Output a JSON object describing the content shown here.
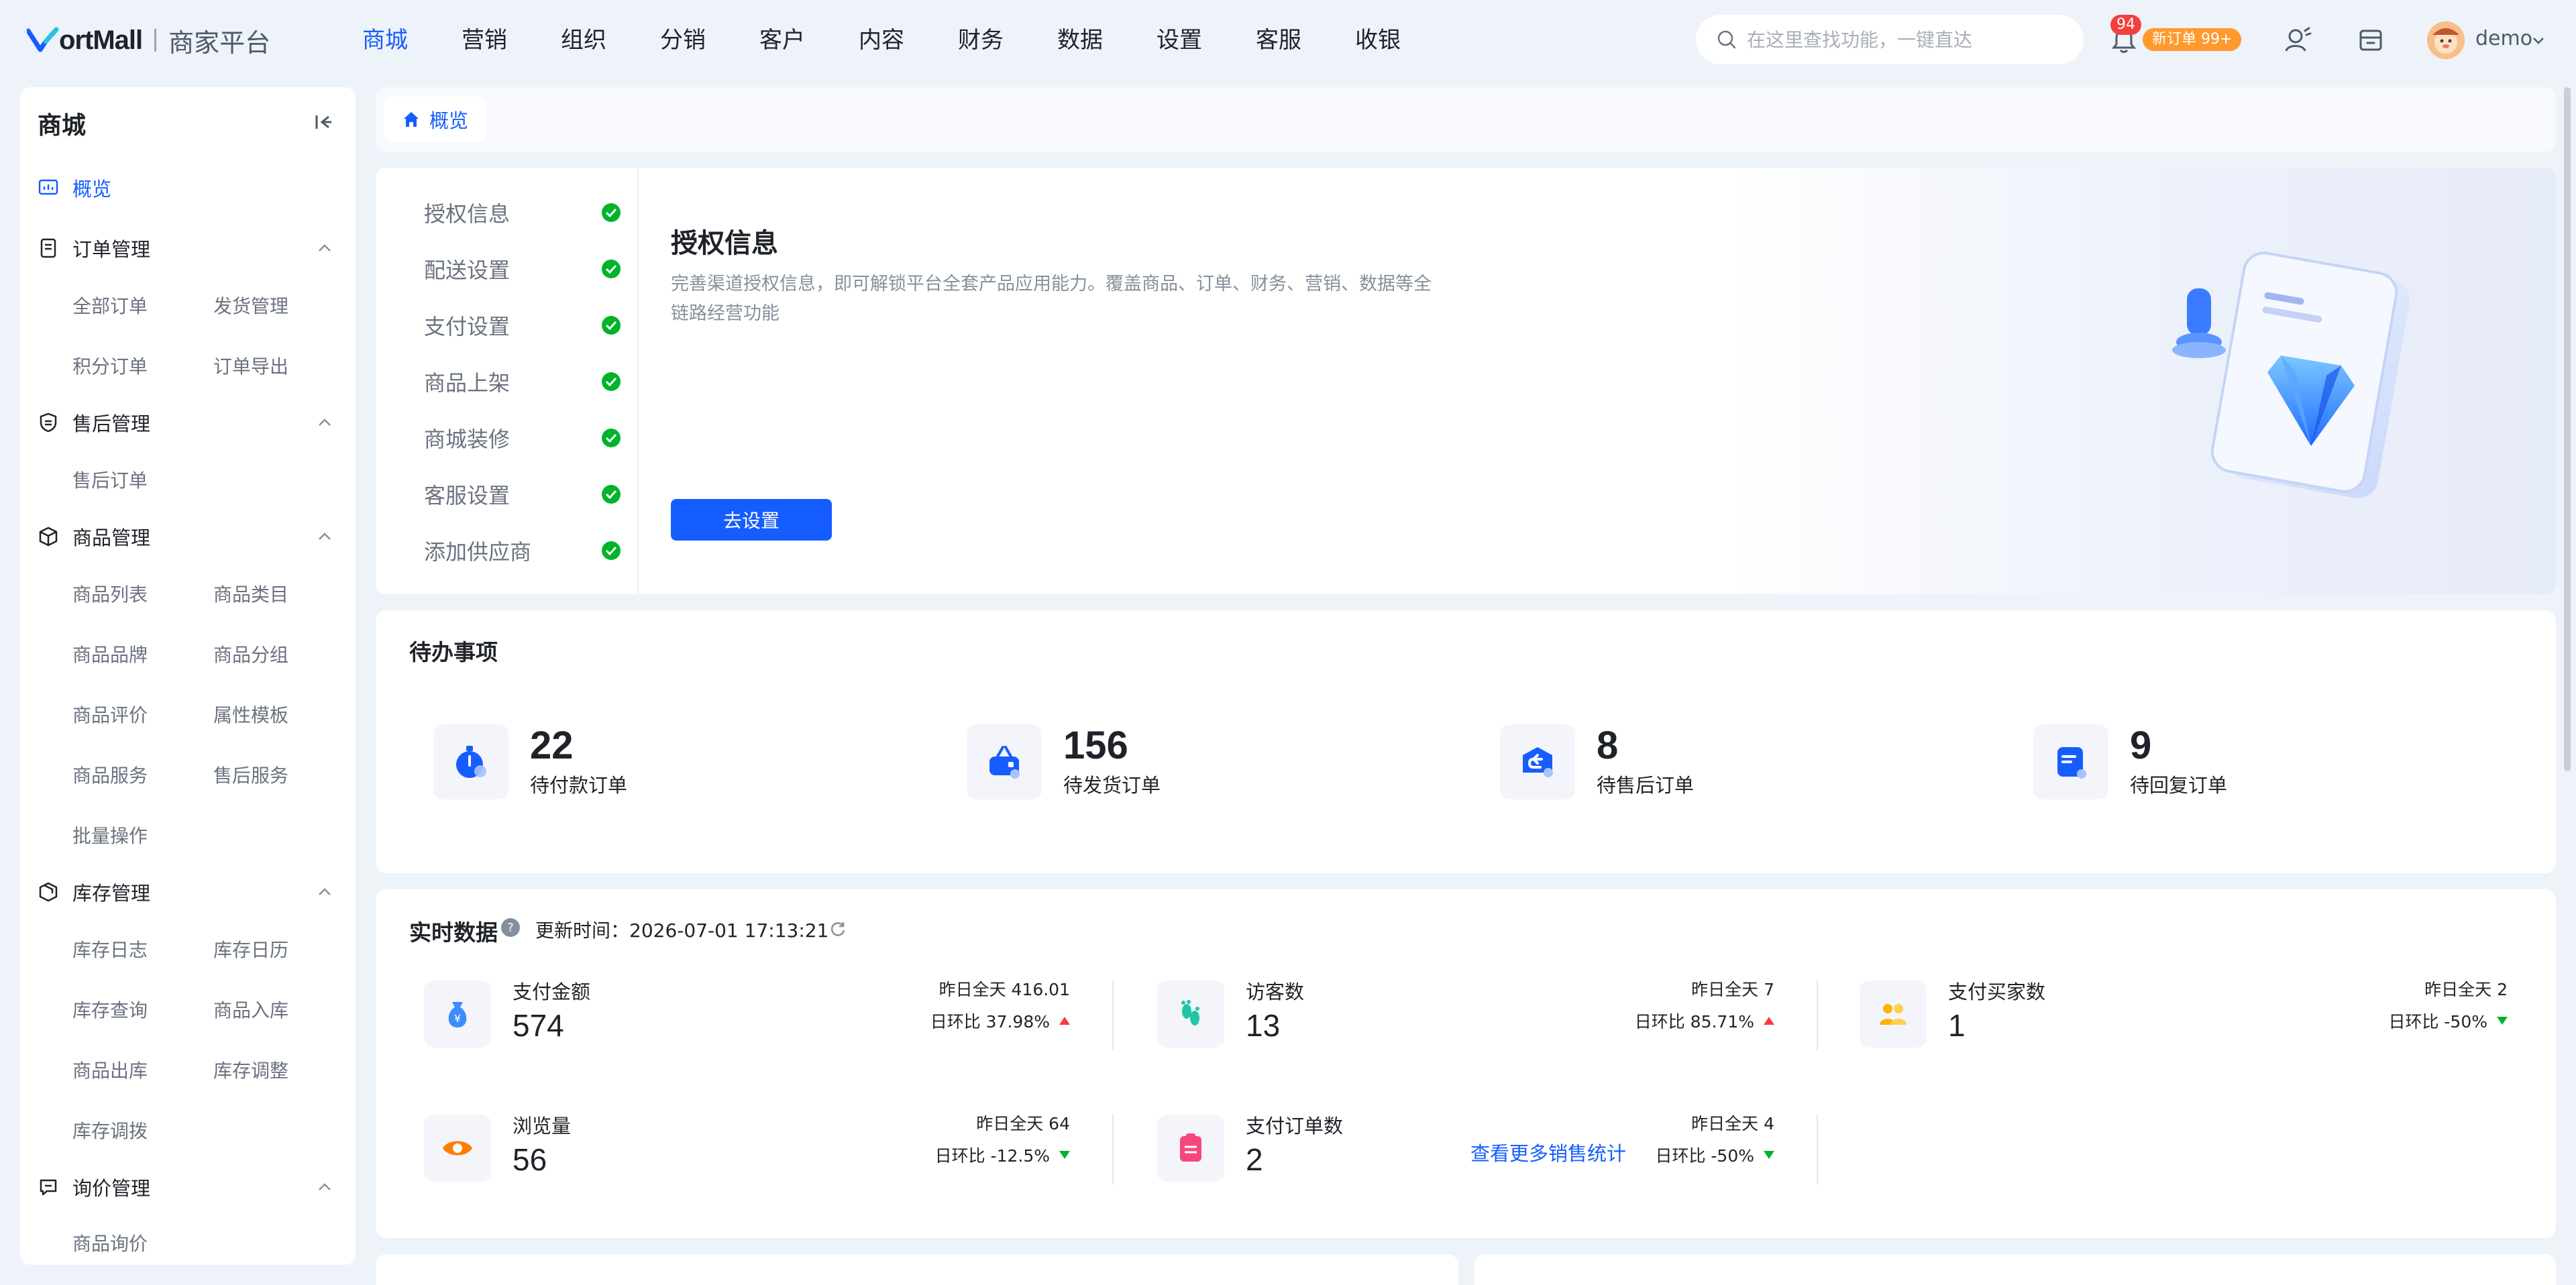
{
  "brand": {
    "logo_text": "ortMall",
    "sub": "商家平台"
  },
  "topnav": [
    "商城",
    "营销",
    "组织",
    "分销",
    "客户",
    "内容",
    "财务",
    "数据",
    "设置",
    "客服",
    "收银"
  ],
  "header": {
    "search_placeholder": "在这里查找功能，一键直达",
    "bell_count": "94",
    "order_badge": "新订单 99+",
    "user": "demo"
  },
  "sidebar": {
    "title": "商城",
    "overview": "概览",
    "groups": [
      {
        "label": "订单管理",
        "items": [
          "全部订单",
          "发货管理",
          "积分订单",
          "订单导出"
        ]
      },
      {
        "label": "售后管理",
        "items": [
          "售后订单"
        ]
      },
      {
        "label": "商品管理",
        "items": [
          "商品列表",
          "商品类目",
          "商品品牌",
          "商品分组",
          "商品评价",
          "属性模板",
          "商品服务",
          "售后服务",
          "批量操作"
        ]
      },
      {
        "label": "库存管理",
        "items": [
          "库存日志",
          "库存日历",
          "库存查询",
          "商品入库",
          "商品出库",
          "库存调整",
          "库存调拨"
        ]
      },
      {
        "label": "询价管理",
        "items": [
          "商品询价"
        ]
      }
    ]
  },
  "breadcrumb": "概览",
  "auth": {
    "steps": [
      "授权信息",
      "配送设置",
      "支付设置",
      "商品上架",
      "商城装修",
      "客服设置",
      "添加供应商"
    ],
    "title": "授权信息",
    "desc": "完善渠道授权信息，即可解锁平台全套产品应用能力。覆盖商品、订单、财务、营销、数据等全链路经营功能",
    "button": "去设置"
  },
  "todo": {
    "title": "待办事项",
    "items": [
      {
        "num": "22",
        "label": "待付款订单"
      },
      {
        "num": "156",
        "label": "待发货订单"
      },
      {
        "num": "8",
        "label": "待售后订单"
      },
      {
        "num": "9",
        "label": "待回复订单"
      }
    ]
  },
  "realtime": {
    "title": "实时数据",
    "update_label": "更新时间：",
    "update_time": "2026-07-01 17:13:21",
    "metrics": [
      {
        "label": "支付金额",
        "value": "574",
        "yest": "昨日全天 416.01",
        "ratio": "日环比  37.98%",
        "trend": "up"
      },
      {
        "label": "访客数",
        "value": "13",
        "yest": "昨日全天 7",
        "ratio": "日环比  85.71%",
        "trend": "up"
      },
      {
        "label": "支付买家数",
        "value": "1",
        "yest": "昨日全天 2",
        "ratio": "日环比  -50%",
        "trend": "down"
      },
      {
        "label": "浏览量",
        "value": "56",
        "yest": "昨日全天 64",
        "ratio": "日环比  -12.5%",
        "trend": "down"
      },
      {
        "label": "支付订单数",
        "value": "2",
        "yest": "昨日全天 4",
        "ratio": "日环比  -50%",
        "trend": "down"
      }
    ],
    "more": "查看更多销售统计"
  },
  "colors": {
    "accent": "#165dff",
    "success": "#00b42a",
    "danger": "#f53f3f",
    "warning": "#ff9a2e"
  }
}
